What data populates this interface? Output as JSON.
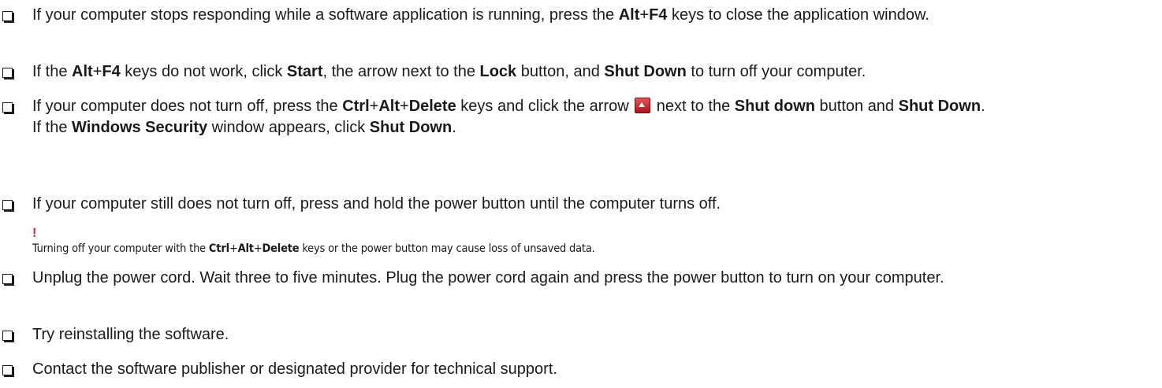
{
  "items": [
    {
      "parts": [
        "If your computer stops responding while a software application is running, press the ",
        "Alt",
        "+",
        "F4",
        " keys to close the application window."
      ]
    },
    {
      "parts": [
        "If the ",
        "Alt",
        "+",
        "F4",
        " keys do not work, click ",
        "Start",
        ", the arrow next to the ",
        "Lock",
        " button, and ",
        "Shut Down",
        " to turn off your computer."
      ]
    },
    {
      "parts": [
        "If your computer does not turn off, press the ",
        "Ctrl",
        "+",
        "Alt",
        "+",
        "Delete",
        " keys and click the arrow ",
        " next to the ",
        "Shut down",
        " button and ",
        "Shut Down",
        "."
      ],
      "sub_parts": [
        "If the ",
        "Windows Security",
        " window appears, click ",
        "Shut Down",
        "."
      ]
    },
    {
      "text": "If your computer still does not turn off, press and hold the power button until the computer turns off."
    },
    {
      "text": "Unplug the power cord. Wait three to five minutes. Plug the power cord again and press the power button to turn on your computer."
    },
    {
      "text": "Try reinstalling the software."
    },
    {
      "text": "Contact the software publisher or designated provider for technical support."
    }
  ],
  "caution": {
    "mark": "!",
    "parts": [
      "Turning off your computer with the ",
      "Ctrl",
      "+",
      "Alt",
      "+",
      "Delete",
      " keys or the power button may cause loss of unsaved data."
    ]
  },
  "icons": {
    "checkbox": "checkbox-icon",
    "arrow": "shutdown-arrow-icon",
    "caution": "caution-icon"
  },
  "colors": {
    "text": "#1a1a1a",
    "caution": "#e02020",
    "arrow_icon": "#c4262e"
  }
}
